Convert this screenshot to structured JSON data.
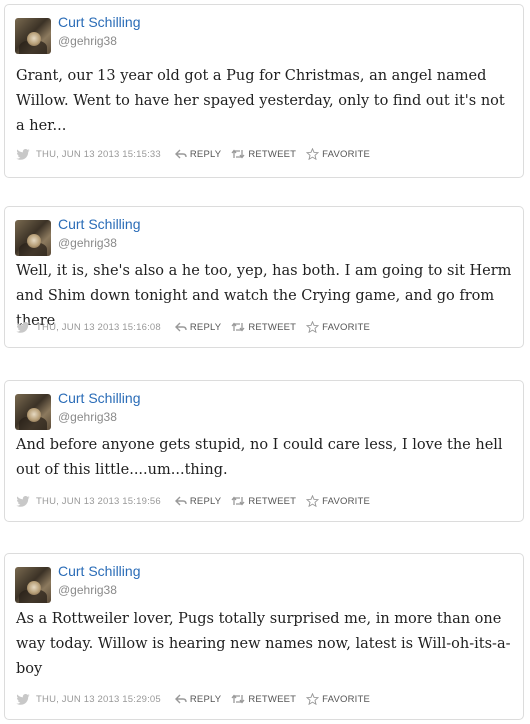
{
  "labels": {
    "reply": "REPLY",
    "retweet": "RETWEET",
    "favorite": "FAVORITE"
  },
  "colors": {
    "name": "#2a6cb7",
    "handle": "#8a8a8a",
    "meta": "#999999"
  },
  "tweets": [
    {
      "name": "Curt Schilling",
      "handle": "@gehrig38",
      "text": "Grant, our 13 year old got a Pug for Christmas, an angel named Willow. Went to have her spayed yesterday, only to find out it's not a her...",
      "timestamp": "THU, JUN 13 2013 15:15:33"
    },
    {
      "name": "Curt Schilling",
      "handle": "@gehrig38",
      "text": "Well, it is, she's also a he too, yep, has both. I am going to sit Herm and Shim down tonight and watch the Crying game, and go from there",
      "timestamp": "THU, JUN 13 2013 15:16:08"
    },
    {
      "name": "Curt Schilling",
      "handle": "@gehrig38",
      "text": "And before anyone gets stupid, no I could care less, I love the hell out of this little....um...thing.",
      "timestamp": "THU, JUN 13 2013 15:19:56"
    },
    {
      "name": "Curt Schilling",
      "handle": "@gehrig38",
      "text": "As a Rottweiler lover, Pugs totally surprised me, in more than one way today. Willow is hearing new names now, latest is Will-oh-its-a-boy",
      "timestamp": "THU, JUN 13 2013 15:29:05"
    }
  ]
}
